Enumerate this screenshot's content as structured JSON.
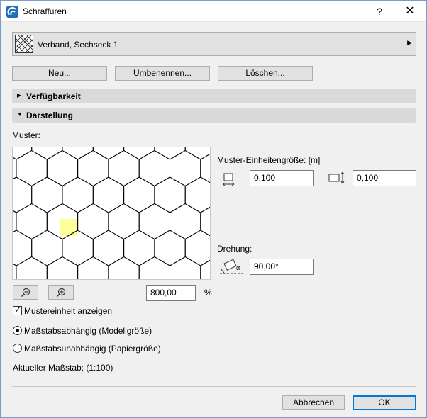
{
  "window": {
    "title": "Schraffuren",
    "help_symbol": "?",
    "close_symbol": "✕"
  },
  "hatch": {
    "name": "Verband, Sechseck 1"
  },
  "buttons": {
    "new": "Neu...",
    "rename": "Umbenennen...",
    "delete": "Löschen..."
  },
  "sections": {
    "availability": "Verfügbarkeit",
    "display": "Darstellung"
  },
  "pattern": {
    "label": "Muster:",
    "unit_size_label": "Muster-Einheitengröße: [m]",
    "width_value": "0,100",
    "height_value": "0,100",
    "rotation_label": "Drehung:",
    "rotation_value": "90,00°",
    "rotation_symbol": "α",
    "zoom_value": "800,00",
    "zoom_unit": "%"
  },
  "options": {
    "show_unit_label": "Mustereinheit anzeigen",
    "show_unit_checked": true,
    "scale_dependent_label": "Maßstabsabhängig (Modellgröße)",
    "scale_independent_label": "Maßstabsunabhängig (Papiergröße)",
    "selected": "scale_dependent",
    "current_scale": "Aktueller Maßstab: (1:100)"
  },
  "footer": {
    "cancel": "Abbrechen",
    "ok": "OK"
  },
  "colors": {
    "unit_highlight": "#ffff99",
    "focus_blue": "#0078d7",
    "section_bg": "#d9d9d9"
  }
}
